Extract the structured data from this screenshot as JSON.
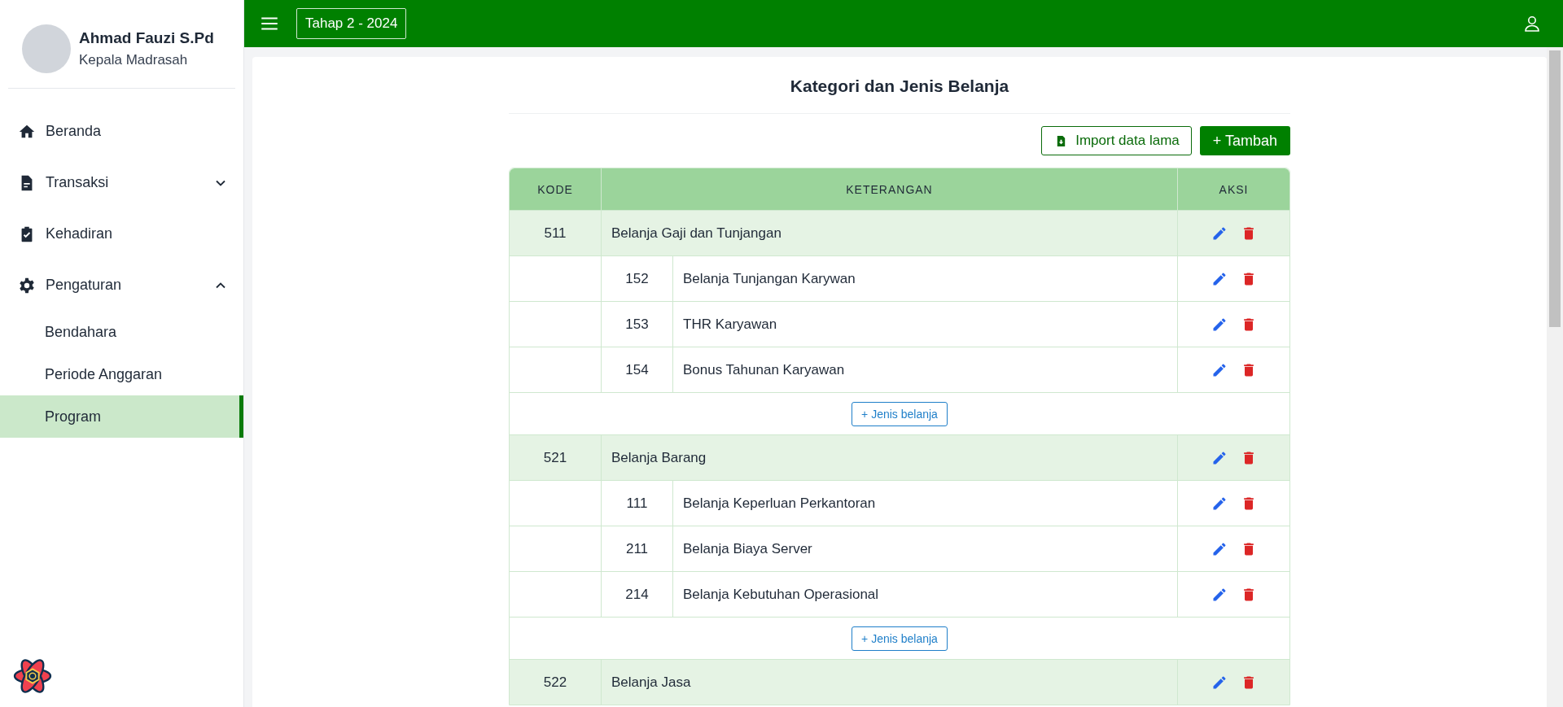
{
  "user": {
    "name": "Ahmad Fauzi S.Pd",
    "role": "Kepala Madrasah"
  },
  "sidebar": {
    "items": [
      {
        "label": "Beranda",
        "selected": false
      },
      {
        "label": "Transaksi",
        "expanded": false,
        "selected": false
      },
      {
        "label": "Kehadiran",
        "selected": false
      },
      {
        "label": "Pengaturan",
        "expanded": true,
        "selected": false,
        "children": [
          {
            "label": "Bendahara",
            "selected": false
          },
          {
            "label": "Periode Anggaran",
            "selected": false
          },
          {
            "label": "Program",
            "selected": true
          }
        ]
      }
    ]
  },
  "topbar": {
    "period": "Tahap 2 - 2024"
  },
  "page": {
    "title": "Kategori dan Jenis Belanja",
    "import_button": "Import data lama",
    "add_button": "+ Tambah"
  },
  "table": {
    "columns": [
      "KODE",
      "KETERANGAN",
      "AKSI"
    ],
    "categories": [
      {
        "code": "511",
        "name": "Belanja Gaji dan Tunjangan",
        "add_label": "+ Jenis belanja",
        "items": [
          {
            "code": "152",
            "name": "Belanja Tunjangan Karywan"
          },
          {
            "code": "153",
            "name": "THR Karyawan"
          },
          {
            "code": "154",
            "name": "Bonus Tahunan Karyawan"
          }
        ]
      },
      {
        "code": "521",
        "name": "Belanja Barang",
        "add_label": "+ Jenis belanja",
        "items": [
          {
            "code": "111",
            "name": "Belanja Keperluan Perkantoran"
          },
          {
            "code": "211",
            "name": "Belanja Biaya Server"
          },
          {
            "code": "214",
            "name": "Belanja Kebutuhan Operasional"
          }
        ]
      },
      {
        "code": "522",
        "name": "Belanja Jasa"
      }
    ]
  }
}
